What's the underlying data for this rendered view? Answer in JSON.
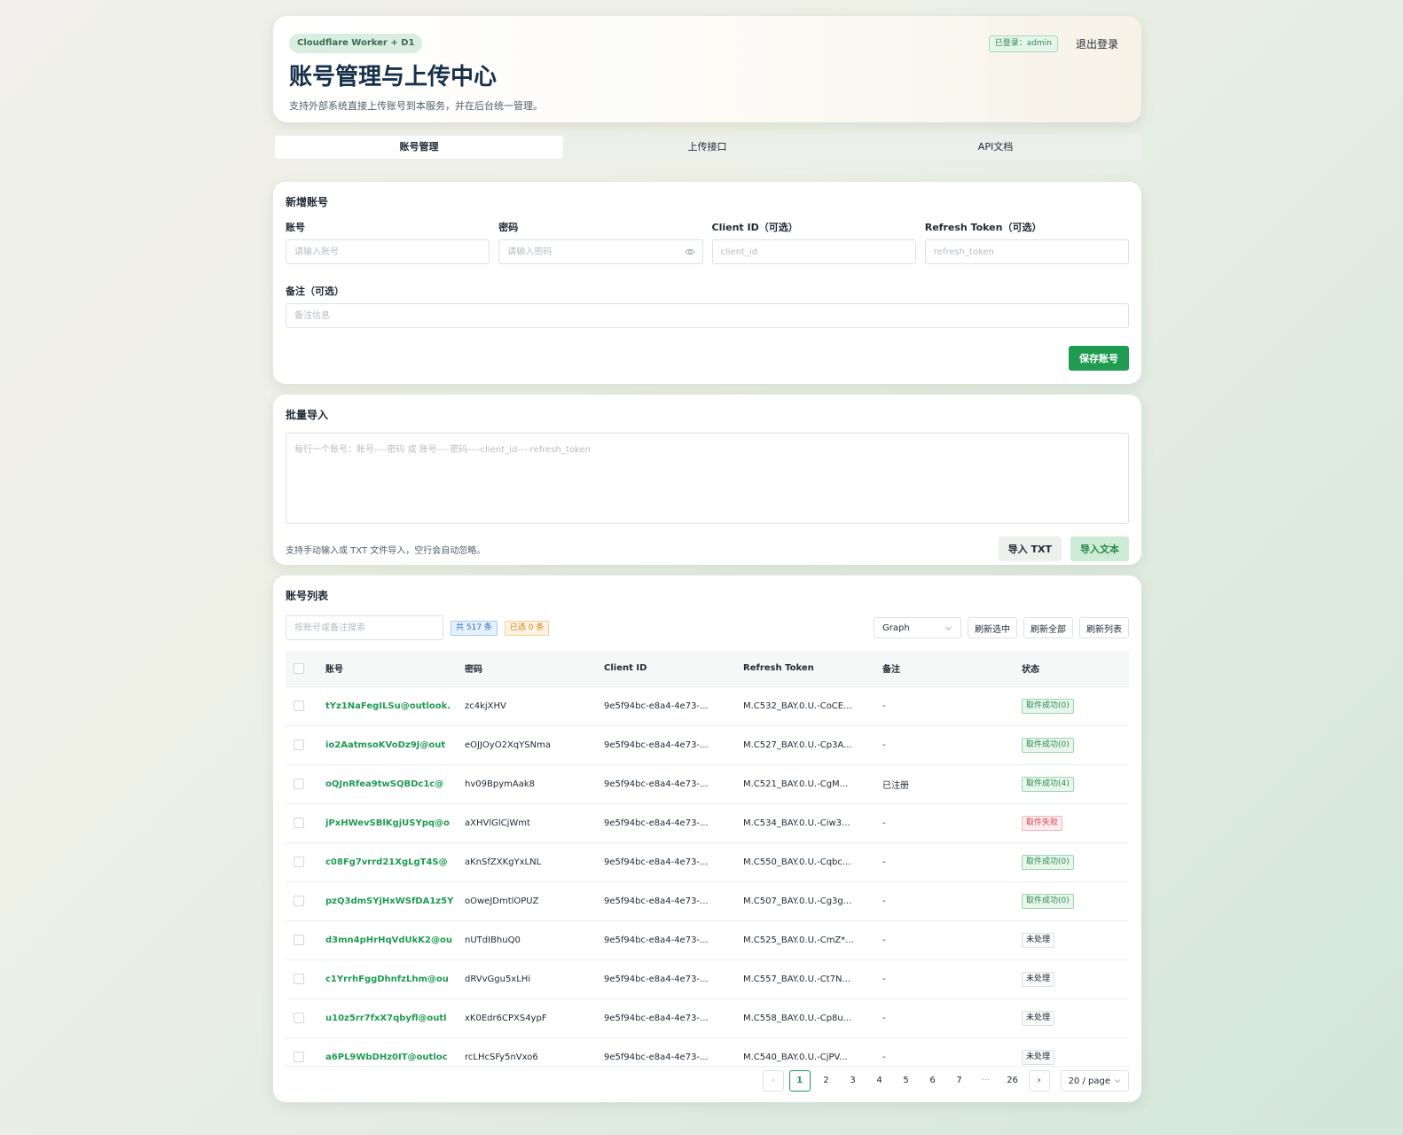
{
  "header": {
    "pill": "Cloudflare Worker + D1",
    "title": "账号管理与上传中心",
    "subtitle": "支持外部系统直接上传账号到本服务，并在后台统一管理。",
    "login_badge": "已登录：admin",
    "logout": "退出登录"
  },
  "tabs": [
    {
      "label": "账号管理",
      "active": true
    },
    {
      "label": "上传接口",
      "active": false
    },
    {
      "label": "API文档",
      "active": false
    }
  ],
  "new_account": {
    "title": "新增账号",
    "fields": [
      {
        "label": "账号",
        "placeholder": "请输入账号"
      },
      {
        "label": "密码",
        "placeholder": "请输入密码"
      },
      {
        "label": "Client ID（可选）",
        "placeholder": "client_id"
      },
      {
        "label": "Refresh Token（可选）",
        "placeholder": "refresh_token"
      }
    ],
    "note_label": "备注（可选）",
    "note_placeholder": "备注信息",
    "save_button": "保存账号"
  },
  "bulk_import": {
    "title": "批量导入",
    "placeholder": "每行一个账号：账号----密码 或 账号----密码----client_id----refresh_token",
    "hint": "支持手动输入或 TXT 文件导入，空行会自动忽略。",
    "import_txt": "导入 TXT",
    "import_text": "导入文本"
  },
  "account_list": {
    "title": "账号列表",
    "search_placeholder": "按账号或备注搜索",
    "total_tag": "共 517 条",
    "selected_tag": "已选 0 条",
    "select_value": "Graph",
    "refresh_selected": "刷新选中",
    "refresh_all": "刷新全部",
    "refresh_list": "刷新列表",
    "columns": [
      "账号",
      "密码",
      "Client ID",
      "Refresh Token",
      "备注",
      "状态"
    ],
    "rows": [
      {
        "account": "tYz1NaFegILSu@outlook.",
        "password": "zc4kjXHV",
        "client_id": "9e5f94bc-e8a4-4e73-...",
        "token": "M.C532_BAY.0.U.-CoCE...",
        "note": "-",
        "status": "取件成功(0)",
        "status_type": "ok"
      },
      {
        "account": "io2AatmsoKVoDz9J@out",
        "password": "eOJJOyO2XqYSNma",
        "client_id": "9e5f94bc-e8a4-4e73-...",
        "token": "M.C527_BAY.0.U.-Cp3A...",
        "note": "-",
        "status": "取件成功(0)",
        "status_type": "ok"
      },
      {
        "account": "oQJnRfea9twSQBDc1c@",
        "password": "hv09BpymAak8",
        "client_id": "9e5f94bc-e8a4-4e73-...",
        "token": "M.C521_BAY.0.U.-CgM...",
        "note": "已注册",
        "status": "取件成功(4)",
        "status_type": "ok"
      },
      {
        "account": "jPxHWevSBlKgjUSYpq@o",
        "password": "aXHVlGlCjWmt",
        "client_id": "9e5f94bc-e8a4-4e73-...",
        "token": "M.C534_BAY.0.U.-Ciw3...",
        "note": "-",
        "status": "取件失败",
        "status_type": "fail"
      },
      {
        "account": "c08Fg7vrrd21XgLgT4S@",
        "password": "aKnSfZXKgYxLNL",
        "client_id": "9e5f94bc-e8a4-4e73-...",
        "token": "M.C550_BAY.0.U.-Cqbc...",
        "note": "-",
        "status": "取件成功(0)",
        "status_type": "ok"
      },
      {
        "account": "pzQ3dmSYjHxWSfDA1z5Y",
        "password": "oOweJDmtlOPUZ",
        "client_id": "9e5f94bc-e8a4-4e73-...",
        "token": "M.C507_BAY.0.U.-Cg3g...",
        "note": "-",
        "status": "取件成功(0)",
        "status_type": "ok"
      },
      {
        "account": "d3mn4pHrHqVdUkK2@ou",
        "password": "nUTdIBhuQ0",
        "client_id": "9e5f94bc-e8a4-4e73-...",
        "token": "M.C525_BAY.0.U.-CmZ*...",
        "note": "-",
        "status": "未处理",
        "status_type": "none"
      },
      {
        "account": "c1YrrhFggDhnfzLhm@ou",
        "password": "dRVvGgu5xLHi",
        "client_id": "9e5f94bc-e8a4-4e73-...",
        "token": "M.C557_BAY.0.U.-Ct7N...",
        "note": "-",
        "status": "未处理",
        "status_type": "none"
      },
      {
        "account": "u10z5rr7fxX7qbyfl@outl",
        "password": "xK0Edr6CPXS4ypF",
        "client_id": "9e5f94bc-e8a4-4e73-...",
        "token": "M.C558_BAY.0.U.-Cp8u...",
        "note": "-",
        "status": "未处理",
        "status_type": "none"
      },
      {
        "account": "a6PL9WbDHz0IT@outloc",
        "password": "rcLHcSFy5nVxo6",
        "client_id": "9e5f94bc-e8a4-4e73-...",
        "token": "M.C540_BAY.0.U.-CjPV...",
        "note": "-",
        "status": "未处理",
        "status_type": "none"
      }
    ]
  },
  "pagination": {
    "prev": "‹",
    "next": "›",
    "pages": [
      "1",
      "2",
      "3",
      "4",
      "5",
      "6",
      "7",
      "···",
      "26"
    ],
    "current": "1",
    "page_size": "20 / page"
  },
  "colors": {
    "accent": "#1f9b52",
    "title": "#17314a"
  }
}
